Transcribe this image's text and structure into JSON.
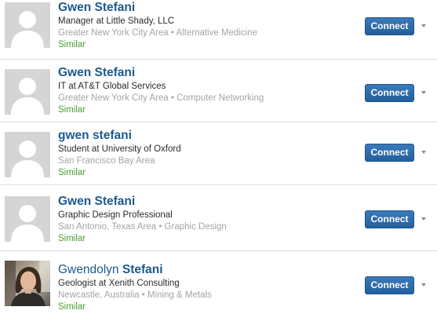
{
  "results": [
    {
      "name_first": "Gwen",
      "name_last": "Stefani",
      "headline": "Manager at Little Shady, LLC",
      "location": "Greater New York City Area",
      "industry": "Alternative Medicine",
      "similar": "Similar",
      "connect": "Connect",
      "avatar": "default-silhouette"
    },
    {
      "name_first": "Gwen",
      "name_last": "Stefani",
      "headline": "IT at AT&T Global Services",
      "location": "Greater New York City Area",
      "industry": "Computer Networking",
      "similar": "Similar",
      "connect": "Connect",
      "avatar": "default-silhouette"
    },
    {
      "name_first": "gwen",
      "name_last": "stefani",
      "headline": "Student at University of Oxford",
      "location": "San Francisco Bay Area",
      "industry": "",
      "similar": "Similar",
      "connect": "Connect",
      "avatar": "default-silhouette"
    },
    {
      "name_first": "Gwen",
      "name_last": "Stefani",
      "headline": "Graphic Design Professional",
      "location": "San Antonio, Texas Area",
      "industry": "Graphic Design",
      "similar": "Similar",
      "connect": "Connect",
      "avatar": "default-silhouette"
    },
    {
      "name_first": "Gwendolyn",
      "name_last": "Stefani",
      "headline": "Geologist at Xenith Consulting",
      "location": "Newcastle, Australia",
      "industry": "Mining & Metals",
      "similar": "Similar",
      "connect": "Connect",
      "avatar": "profile-photo"
    }
  ],
  "separator": "•",
  "colors": {
    "name": "#1b5a8f",
    "meta": "#a4a4a4",
    "similar": "#4d9e35",
    "button": "#2d6dad"
  }
}
